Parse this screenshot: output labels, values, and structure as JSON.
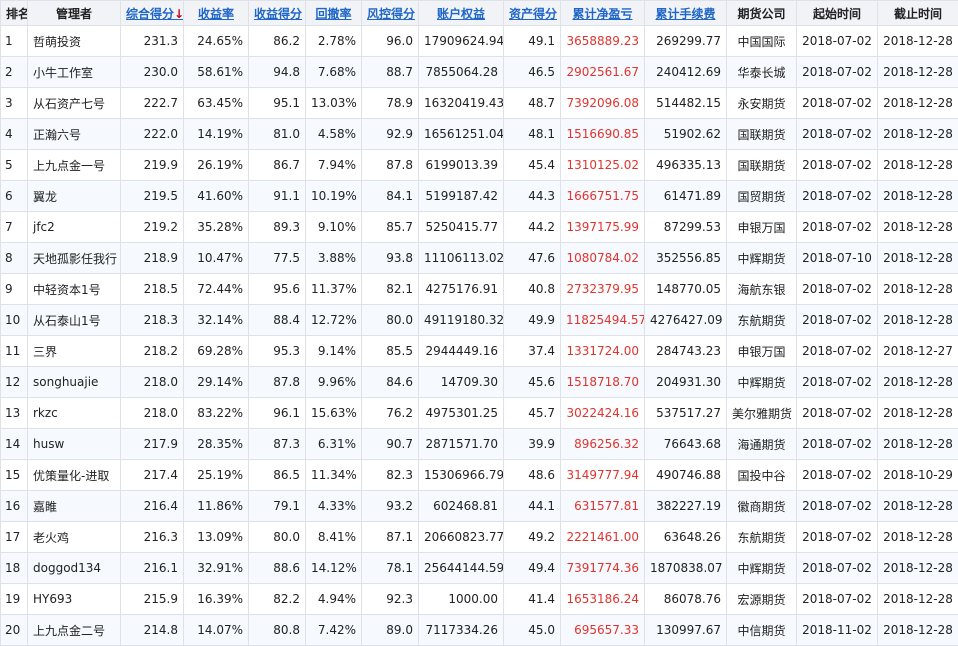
{
  "table": {
    "headers": [
      {
        "label": "排名",
        "sortable": false
      },
      {
        "label": "管理者",
        "sortable": false
      },
      {
        "label": "综合得分",
        "sortable": true,
        "sort_arrow": "↓"
      },
      {
        "label": "收益率",
        "sortable": true
      },
      {
        "label": "收益得分",
        "sortable": true
      },
      {
        "label": "回撤率",
        "sortable": true
      },
      {
        "label": "风控得分",
        "sortable": true
      },
      {
        "label": "账户权益",
        "sortable": true
      },
      {
        "label": "资产得分",
        "sortable": true
      },
      {
        "label": "累计净盈亏",
        "sortable": true
      },
      {
        "label": "累计手续费",
        "sortable": true
      },
      {
        "label": "期货公司",
        "sortable": false
      },
      {
        "label": "起始时间",
        "sortable": false
      },
      {
        "label": "截止时间",
        "sortable": false
      }
    ],
    "rows": [
      [
        "1",
        "哲萌投资",
        "231.3",
        "24.65%",
        "86.2",
        "2.78%",
        "96.0",
        "17909624.94",
        "49.1",
        "3658889.23",
        "269299.77",
        "中国国际",
        "2018-07-02",
        "2018-12-28"
      ],
      [
        "2",
        "小牛工作室",
        "230.0",
        "58.61%",
        "94.8",
        "7.68%",
        "88.7",
        "7855064.28",
        "46.5",
        "2902561.67",
        "240412.69",
        "华泰长城",
        "2018-07-02",
        "2018-12-28"
      ],
      [
        "3",
        "从石资产七号",
        "222.7",
        "63.45%",
        "95.1",
        "13.03%",
        "78.9",
        "16320419.43",
        "48.7",
        "7392096.08",
        "514482.15",
        "永安期货",
        "2018-07-02",
        "2018-12-28"
      ],
      [
        "4",
        "正瀚六号",
        "222.0",
        "14.19%",
        "81.0",
        "4.58%",
        "92.9",
        "16561251.04",
        "48.1",
        "1516690.85",
        "51902.62",
        "国联期货",
        "2018-07-02",
        "2018-12-28"
      ],
      [
        "5",
        "上九点金一号",
        "219.9",
        "26.19%",
        "86.7",
        "7.94%",
        "87.8",
        "6199013.39",
        "45.4",
        "1310125.02",
        "496335.13",
        "国联期货",
        "2018-07-02",
        "2018-12-28"
      ],
      [
        "6",
        "翼龙",
        "219.5",
        "41.60%",
        "91.1",
        "10.19%",
        "84.1",
        "5199187.42",
        "44.3",
        "1666751.75",
        "61471.89",
        "国贸期货",
        "2018-07-02",
        "2018-12-28"
      ],
      [
        "7",
        "jfc2",
        "219.2",
        "35.28%",
        "89.3",
        "9.10%",
        "85.7",
        "5250415.77",
        "44.2",
        "1397175.99",
        "87299.53",
        "申银万国",
        "2018-07-02",
        "2018-12-28"
      ],
      [
        "8",
        "天地孤影任我行",
        "218.9",
        "10.47%",
        "77.5",
        "3.88%",
        "93.8",
        "11106113.02",
        "47.6",
        "1080784.02",
        "352556.85",
        "中辉期货",
        "2018-07-10",
        "2018-12-28"
      ],
      [
        "9",
        "中轻资本1号",
        "218.5",
        "72.44%",
        "95.6",
        "11.37%",
        "82.1",
        "4275176.91",
        "40.8",
        "2732379.95",
        "148770.05",
        "海航东银",
        "2018-07-02",
        "2018-12-28"
      ],
      [
        "10",
        "从石泰山1号",
        "218.3",
        "32.14%",
        "88.4",
        "12.72%",
        "80.0",
        "49119180.32",
        "49.9",
        "11825494.57",
        "4276427.09",
        "东航期货",
        "2018-07-02",
        "2018-12-28"
      ],
      [
        "11",
        "三界",
        "218.2",
        "69.28%",
        "95.3",
        "9.14%",
        "85.5",
        "2944449.16",
        "37.4",
        "1331724.00",
        "284743.23",
        "申银万国",
        "2018-07-02",
        "2018-12-27"
      ],
      [
        "12",
        "songhuajie",
        "218.0",
        "29.14%",
        "87.8",
        "9.96%",
        "84.6",
        "14709.30",
        "45.6",
        "1518718.70",
        "204931.30",
        "中辉期货",
        "2018-07-02",
        "2018-12-28"
      ],
      [
        "13",
        "rkzc",
        "218.0",
        "83.22%",
        "96.1",
        "15.63%",
        "76.2",
        "4975301.25",
        "45.7",
        "3022424.16",
        "537517.27",
        "美尔雅期货",
        "2018-07-02",
        "2018-12-28"
      ],
      [
        "14",
        "husw",
        "217.9",
        "28.35%",
        "87.3",
        "6.31%",
        "90.7",
        "2871571.70",
        "39.9",
        "896256.32",
        "76643.68",
        "海通期货",
        "2018-07-02",
        "2018-12-28"
      ],
      [
        "15",
        "优策量化-进取",
        "217.4",
        "25.19%",
        "86.5",
        "11.34%",
        "82.3",
        "15306966.79",
        "48.6",
        "3149777.94",
        "490746.88",
        "国投中谷",
        "2018-07-02",
        "2018-10-29"
      ],
      [
        "16",
        "嘉睢",
        "216.4",
        "11.86%",
        "79.1",
        "4.33%",
        "93.2",
        "602468.81",
        "44.1",
        "631577.81",
        "382227.19",
        "徽商期货",
        "2018-07-02",
        "2018-12-28"
      ],
      [
        "17",
        "老火鸡",
        "216.3",
        "13.09%",
        "80.0",
        "8.41%",
        "87.1",
        "20660823.77",
        "49.2",
        "2221461.00",
        "63648.26",
        "东航期货",
        "2018-07-02",
        "2018-12-28"
      ],
      [
        "18",
        "doggod134",
        "216.1",
        "32.91%",
        "88.6",
        "14.12%",
        "78.1",
        "25644144.59",
        "49.4",
        "7391774.36",
        "1870838.07",
        "中辉期货",
        "2018-07-02",
        "2018-12-28"
      ],
      [
        "19",
        "HY693",
        "215.9",
        "16.39%",
        "82.2",
        "4.94%",
        "92.3",
        "1000.00",
        "41.4",
        "1653186.24",
        "86078.76",
        "宏源期货",
        "2018-07-02",
        "2018-12-28"
      ],
      [
        "20",
        "上九点金二号",
        "214.8",
        "14.07%",
        "80.8",
        "7.42%",
        "89.0",
        "7117334.26",
        "45.0",
        "695657.33",
        "130997.67",
        "中信期货",
        "2018-11-02",
        "2018-12-28"
      ]
    ]
  }
}
